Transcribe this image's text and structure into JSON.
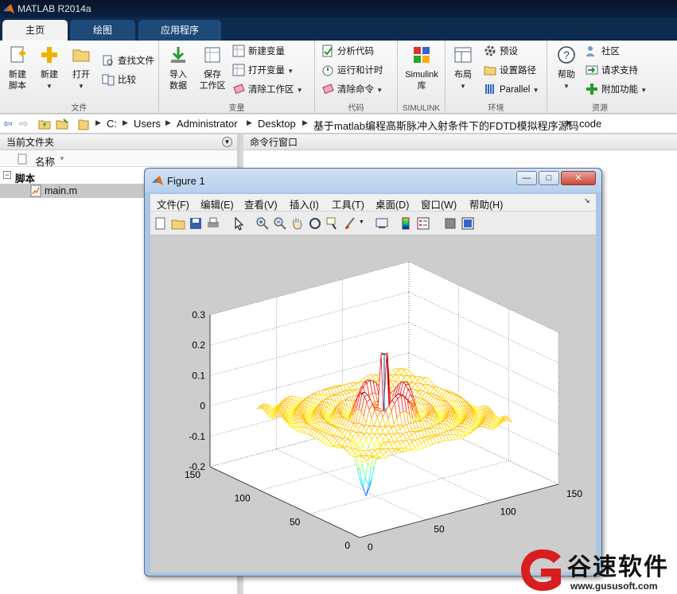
{
  "app": {
    "title": "MATLAB R2014a"
  },
  "tabs": [
    {
      "label": "主页"
    },
    {
      "label": "绘图"
    },
    {
      "label": "应用程序"
    }
  ],
  "ribbon": {
    "file": {
      "label": "文件",
      "new_script": "新建\n脚本",
      "new": "新建",
      "open": "打开",
      "find_files": "查找文件",
      "compare": "比较"
    },
    "variable": {
      "label": "变量",
      "import": "导入\n数据",
      "save_ws": "保存\n工作区",
      "new_var": "新建变量",
      "open_var": "打开变量",
      "clear_ws": "清除工作区"
    },
    "code": {
      "label": "代码",
      "analyze": "分析代码",
      "run_time": "运行和计时",
      "clear_cmd": "清除命令"
    },
    "simulink": {
      "label": "SIMULINK",
      "lib": "Simulink\n库"
    },
    "env": {
      "label": "环境",
      "layout": "布局",
      "prefs": "预设",
      "set_path": "设置路径",
      "parallel": "Parallel"
    },
    "resources": {
      "label": "资源",
      "help": "帮助",
      "community": "社区",
      "support": "请求支持",
      "addons": "附加功能"
    }
  },
  "address": {
    "path": [
      "C:",
      "Users",
      "Administrator",
      "Desktop",
      "基于matlab编程高斯脉冲入射条件下的FDTD模拟程序源码",
      "code"
    ]
  },
  "current_folder": {
    "title": "当前文件夹",
    "col_name": "名称",
    "group": "脚本",
    "files": [
      {
        "name": "main.m"
      }
    ]
  },
  "command_window": {
    "title": "命令行窗口"
  },
  "figure": {
    "title": "Figure 1",
    "menus": [
      "文件(F)",
      "编辑(E)",
      "查看(V)",
      "插入(I)",
      "工具(T)",
      "桌面(D)",
      "窗口(W)",
      "帮助(H)"
    ],
    "controls": {
      "minimize": "—",
      "maximize": "□",
      "close": "✕"
    }
  },
  "chart_data": {
    "type": "mesh3d",
    "zlim": [
      -0.2,
      0.3
    ],
    "z_ticks": [
      "0.3",
      "0.2",
      "0.1",
      "0",
      "-0.1",
      "-0.2"
    ],
    "xlim": [
      0,
      150
    ],
    "x_ticks": [
      "0",
      "50",
      "100",
      "150"
    ],
    "ylim": [
      0,
      150
    ],
    "y_ticks": [
      "0",
      "50",
      "100",
      "150"
    ],
    "grid": true,
    "colormap": "jet",
    "description_values": {
      "peak_z": 0.2,
      "min_z": -0.2
    }
  },
  "watermark": {
    "brand": "谷速软件",
    "url": "www.gususoft.com"
  },
  "colors": {
    "brand_red": "#d81e1e",
    "matlab_orange": "#e0701a"
  }
}
